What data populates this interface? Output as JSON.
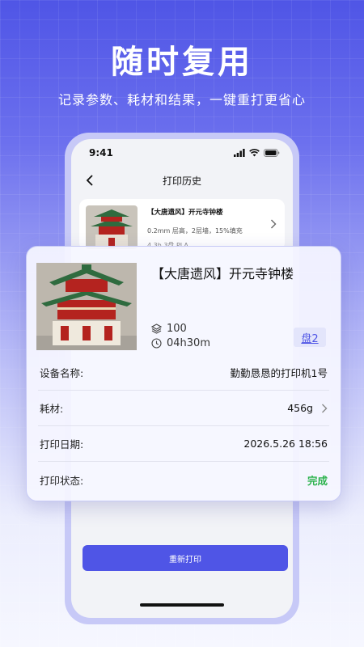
{
  "promo": {
    "headline": "随时复用",
    "subline": "记录参数、耗材和结果，一键重打更省心"
  },
  "status_bar": {
    "time": "9:41"
  },
  "nav": {
    "title": "打印历史"
  },
  "history_item": {
    "title": "【大唐遗风】开元寺钟楼",
    "desc": "0.2mm 层高，2层墙，15%填充",
    "meta": "4.3h  3盘  PLA"
  },
  "detail": {
    "title": "【大唐遗风】开元寺钟楼",
    "layers": "100",
    "duration": "04h30m",
    "plate_badge": "盘2",
    "rows": [
      {
        "label": "设备名称:",
        "value": "勤勤恳恳的打印机1号"
      },
      {
        "label": "耗材:",
        "value": "456g"
      },
      {
        "label": "打印日期:",
        "value": "2026.5.26 18:56"
      },
      {
        "label": "打印状态:",
        "value": "完成"
      }
    ]
  },
  "actions": {
    "reprint_label": "重新打印"
  },
  "colors": {
    "accent": "#4f55e6",
    "status_done": "#2bb24c"
  }
}
